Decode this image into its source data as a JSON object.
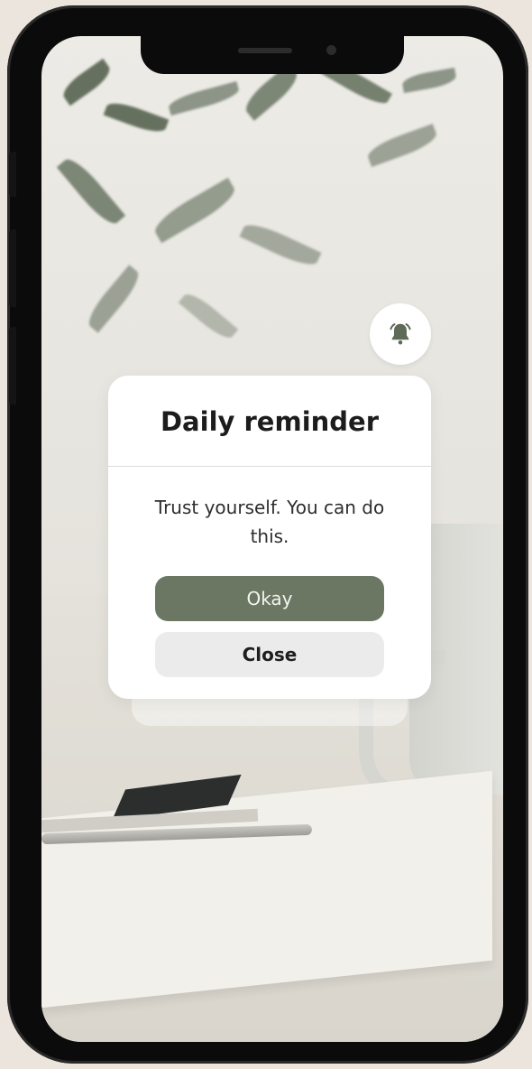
{
  "notification": {
    "title": "Daily reminder",
    "message": "Trust yourself. You can do this.",
    "primary_label": "Okay",
    "secondary_label": "Close"
  },
  "icons": {
    "alert": "bell-icon"
  },
  "colors": {
    "primary_button": "#6b7762",
    "secondary_button": "#ebebeb",
    "card": "#ffffff"
  }
}
